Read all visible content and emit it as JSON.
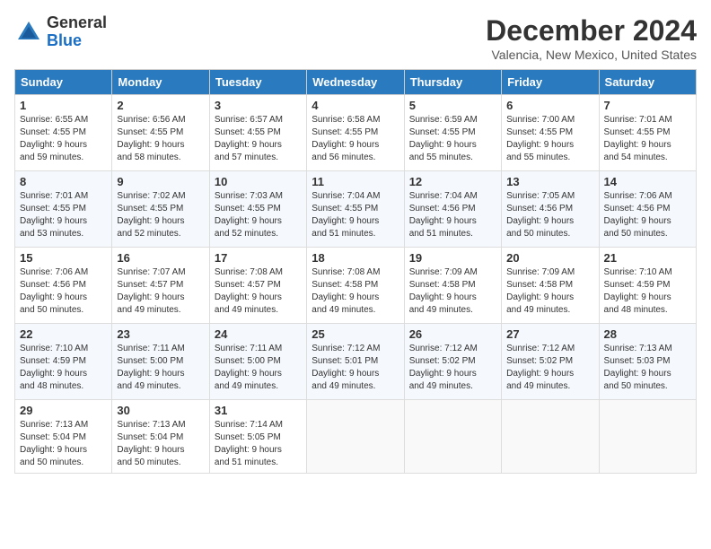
{
  "header": {
    "logo_line1": "General",
    "logo_line2": "Blue",
    "title": "December 2024",
    "subtitle": "Valencia, New Mexico, United States"
  },
  "columns": [
    "Sunday",
    "Monday",
    "Tuesday",
    "Wednesday",
    "Thursday",
    "Friday",
    "Saturday"
  ],
  "weeks": [
    [
      {
        "day": "1",
        "info": "Sunrise: 6:55 AM\nSunset: 4:55 PM\nDaylight: 9 hours\nand 59 minutes."
      },
      {
        "day": "2",
        "info": "Sunrise: 6:56 AM\nSunset: 4:55 PM\nDaylight: 9 hours\nand 58 minutes."
      },
      {
        "day": "3",
        "info": "Sunrise: 6:57 AM\nSunset: 4:55 PM\nDaylight: 9 hours\nand 57 minutes."
      },
      {
        "day": "4",
        "info": "Sunrise: 6:58 AM\nSunset: 4:55 PM\nDaylight: 9 hours\nand 56 minutes."
      },
      {
        "day": "5",
        "info": "Sunrise: 6:59 AM\nSunset: 4:55 PM\nDaylight: 9 hours\nand 55 minutes."
      },
      {
        "day": "6",
        "info": "Sunrise: 7:00 AM\nSunset: 4:55 PM\nDaylight: 9 hours\nand 55 minutes."
      },
      {
        "day": "7",
        "info": "Sunrise: 7:01 AM\nSunset: 4:55 PM\nDaylight: 9 hours\nand 54 minutes."
      }
    ],
    [
      {
        "day": "8",
        "info": "Sunrise: 7:01 AM\nSunset: 4:55 PM\nDaylight: 9 hours\nand 53 minutes."
      },
      {
        "day": "9",
        "info": "Sunrise: 7:02 AM\nSunset: 4:55 PM\nDaylight: 9 hours\nand 52 minutes."
      },
      {
        "day": "10",
        "info": "Sunrise: 7:03 AM\nSunset: 4:55 PM\nDaylight: 9 hours\nand 52 minutes."
      },
      {
        "day": "11",
        "info": "Sunrise: 7:04 AM\nSunset: 4:55 PM\nDaylight: 9 hours\nand 51 minutes."
      },
      {
        "day": "12",
        "info": "Sunrise: 7:04 AM\nSunset: 4:56 PM\nDaylight: 9 hours\nand 51 minutes."
      },
      {
        "day": "13",
        "info": "Sunrise: 7:05 AM\nSunset: 4:56 PM\nDaylight: 9 hours\nand 50 minutes."
      },
      {
        "day": "14",
        "info": "Sunrise: 7:06 AM\nSunset: 4:56 PM\nDaylight: 9 hours\nand 50 minutes."
      }
    ],
    [
      {
        "day": "15",
        "info": "Sunrise: 7:06 AM\nSunset: 4:56 PM\nDaylight: 9 hours\nand 50 minutes."
      },
      {
        "day": "16",
        "info": "Sunrise: 7:07 AM\nSunset: 4:57 PM\nDaylight: 9 hours\nand 49 minutes."
      },
      {
        "day": "17",
        "info": "Sunrise: 7:08 AM\nSunset: 4:57 PM\nDaylight: 9 hours\nand 49 minutes."
      },
      {
        "day": "18",
        "info": "Sunrise: 7:08 AM\nSunset: 4:58 PM\nDaylight: 9 hours\nand 49 minutes."
      },
      {
        "day": "19",
        "info": "Sunrise: 7:09 AM\nSunset: 4:58 PM\nDaylight: 9 hours\nand 49 minutes."
      },
      {
        "day": "20",
        "info": "Sunrise: 7:09 AM\nSunset: 4:58 PM\nDaylight: 9 hours\nand 49 minutes."
      },
      {
        "day": "21",
        "info": "Sunrise: 7:10 AM\nSunset: 4:59 PM\nDaylight: 9 hours\nand 48 minutes."
      }
    ],
    [
      {
        "day": "22",
        "info": "Sunrise: 7:10 AM\nSunset: 4:59 PM\nDaylight: 9 hours\nand 48 minutes."
      },
      {
        "day": "23",
        "info": "Sunrise: 7:11 AM\nSunset: 5:00 PM\nDaylight: 9 hours\nand 49 minutes."
      },
      {
        "day": "24",
        "info": "Sunrise: 7:11 AM\nSunset: 5:00 PM\nDaylight: 9 hours\nand 49 minutes."
      },
      {
        "day": "25",
        "info": "Sunrise: 7:12 AM\nSunset: 5:01 PM\nDaylight: 9 hours\nand 49 minutes."
      },
      {
        "day": "26",
        "info": "Sunrise: 7:12 AM\nSunset: 5:02 PM\nDaylight: 9 hours\nand 49 minutes."
      },
      {
        "day": "27",
        "info": "Sunrise: 7:12 AM\nSunset: 5:02 PM\nDaylight: 9 hours\nand 49 minutes."
      },
      {
        "day": "28",
        "info": "Sunrise: 7:13 AM\nSunset: 5:03 PM\nDaylight: 9 hours\nand 50 minutes."
      }
    ],
    [
      {
        "day": "29",
        "info": "Sunrise: 7:13 AM\nSunset: 5:04 PM\nDaylight: 9 hours\nand 50 minutes."
      },
      {
        "day": "30",
        "info": "Sunrise: 7:13 AM\nSunset: 5:04 PM\nDaylight: 9 hours\nand 50 minutes."
      },
      {
        "day": "31",
        "info": "Sunrise: 7:14 AM\nSunset: 5:05 PM\nDaylight: 9 hours\nand 51 minutes."
      },
      null,
      null,
      null,
      null
    ]
  ]
}
